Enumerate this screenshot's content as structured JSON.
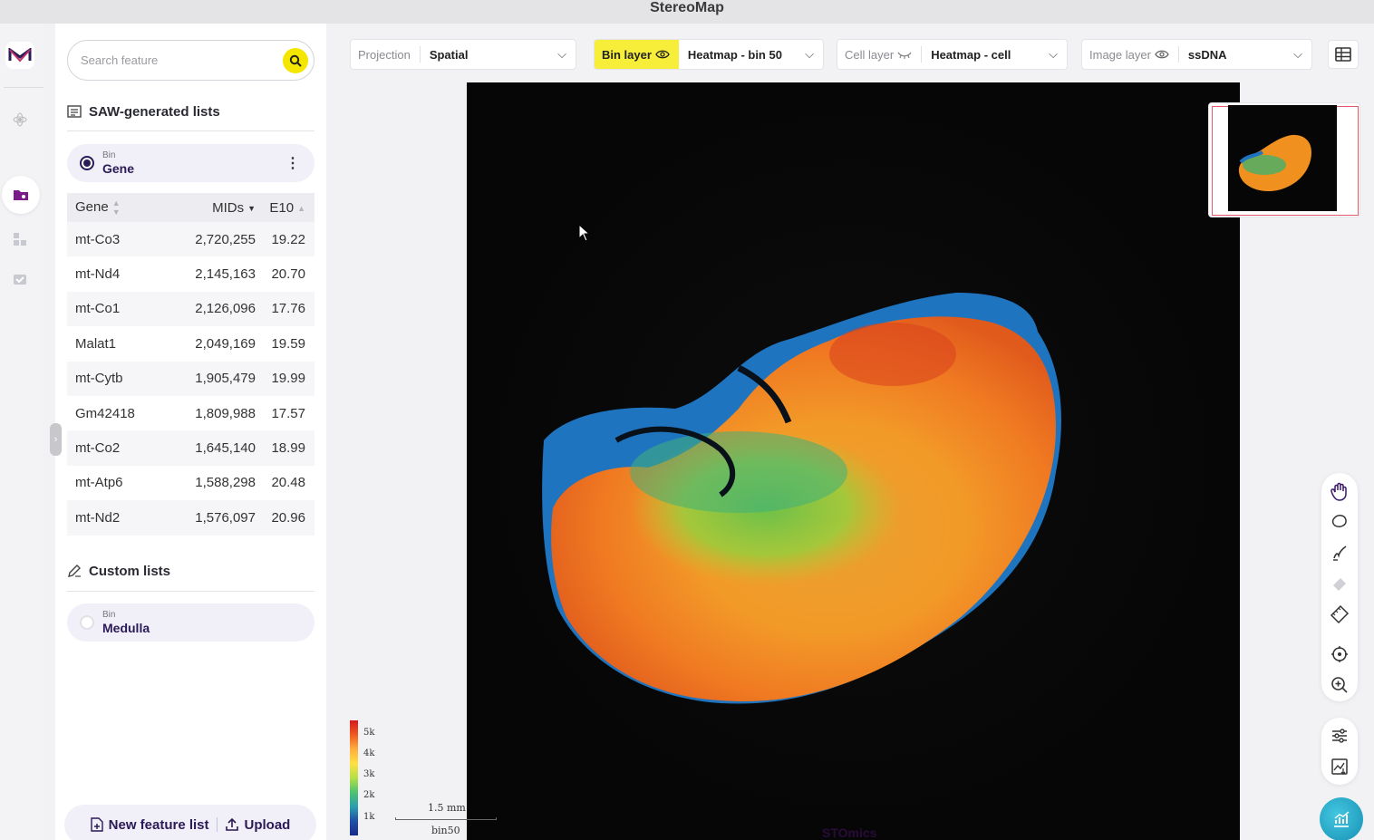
{
  "app": {
    "title": "StereoMap"
  },
  "search": {
    "placeholder": "Search feature"
  },
  "saw_section": {
    "title": "SAW-generated lists"
  },
  "gene_list": {
    "type": "Bin",
    "name": "Gene"
  },
  "table": {
    "headers": [
      "Gene",
      "MIDs",
      "E10"
    ],
    "rows": [
      [
        "mt-Co3",
        "2,720,255",
        "19.22"
      ],
      [
        "mt-Nd4",
        "2,145,163",
        "20.70"
      ],
      [
        "mt-Co1",
        "2,126,096",
        "17.76"
      ],
      [
        "Malat1",
        "2,049,169",
        "19.59"
      ],
      [
        "mt-Cytb",
        "1,905,479",
        "19.99"
      ],
      [
        "Gm42418",
        "1,809,988",
        "17.57"
      ],
      [
        "mt-Co2",
        "1,645,140",
        "18.99"
      ],
      [
        "mt-Atp6",
        "1,588,298",
        "20.48"
      ],
      [
        "mt-Nd2",
        "1,576,097",
        "20.96"
      ]
    ]
  },
  "custom_section": {
    "title": "Custom lists"
  },
  "medulla_list": {
    "type": "Bin",
    "name": "Medulla"
  },
  "actions": {
    "new_list": "New feature list",
    "upload": "Upload"
  },
  "toolbar": {
    "projection_label": "Projection",
    "projection_value": "Spatial",
    "bin_label": "Bin layer",
    "bin_value": "Heatmap - bin 50",
    "cell_label": "Cell layer",
    "cell_value": "Heatmap - cell",
    "image_label": "Image layer",
    "image_value": "ssDNA"
  },
  "legend": {
    "ticks": [
      "5k",
      "4k",
      "3k",
      "2k",
      "1k"
    ]
  },
  "scalebar": {
    "length": "1.5 mm",
    "unit": "bin50"
  },
  "watermark": "STOmics",
  "colors": {
    "accent_yellow": "#f7ee3a",
    "brand_purple": "#2a1a55",
    "fab_teal": "#2aa8cc"
  }
}
